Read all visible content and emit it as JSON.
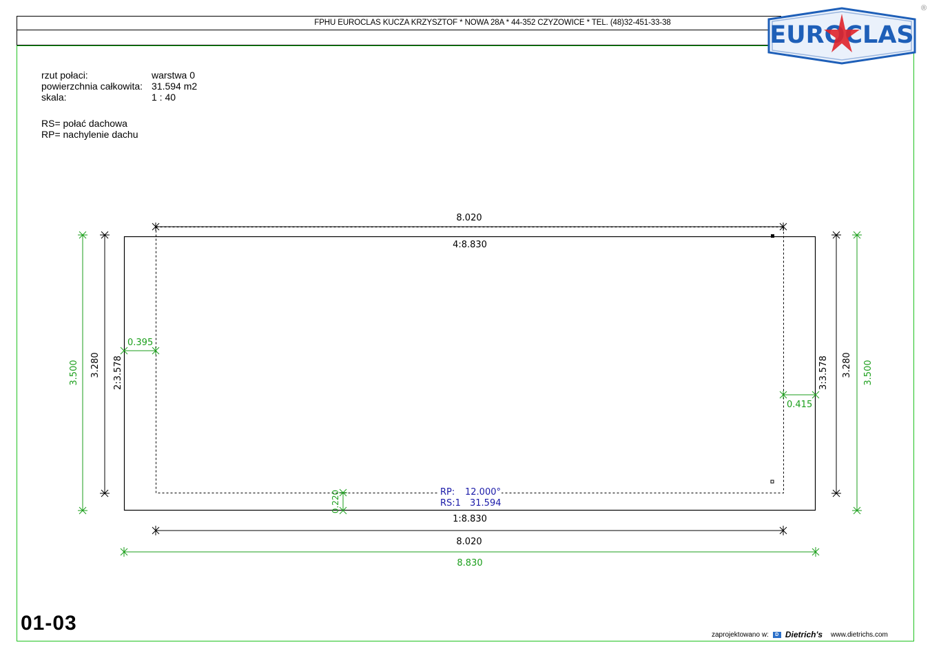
{
  "header": {
    "company_line": "FPHU EUROCLAS KUCZA KRZYSZTOF * NOWA 28A * 44-352 CZYZOWICE * TEL. (48)32-451-33-38",
    "logo_text": "EUROCLAS",
    "registered_mark": "®"
  },
  "info": {
    "rows": [
      {
        "label": "rzut połaci:",
        "value": "warstwa 0"
      },
      {
        "label": "powierzchnia całkowita:",
        "value": "31.594 m2"
      },
      {
        "label": "skala:",
        "value": "1 : 40"
      }
    ],
    "legend": [
      "RS= połać dachowa",
      "RP= nachylenie dachu"
    ]
  },
  "drawing": {
    "top_inner_width": "8.020",
    "top_edge_label": "4:8.830",
    "bottom_edge_label": "1:8.830",
    "bottom_inner_width": "8.020",
    "bottom_total_width": "8.830",
    "left_total_height": "3.500",
    "left_inner_height": "3.280",
    "left_edge_label": "2:3.578",
    "right_edge_label": "3:3.578",
    "right_inner_height": "3.280",
    "right_total_height": "3.500",
    "left_overhang": "0.395",
    "right_overhang": "0.415",
    "bottom_overhang": "0.220",
    "rp_label": "RP:",
    "rp_value": "12.000°",
    "rs_label": "RS:1",
    "rs_value": "31.594"
  },
  "footer": {
    "sheet_number": "01-03",
    "designed_with": "zaprojektowano w:",
    "brand": "Dietrich's",
    "website": "www.dietrichs.com"
  },
  "colors": {
    "border_green": "#1fc21f",
    "dimension_green": "#1a9e1a",
    "annotation_blue": "#1a1aa8",
    "logo_blue": "#1e5fb8",
    "logo_red": "#e0242a"
  }
}
